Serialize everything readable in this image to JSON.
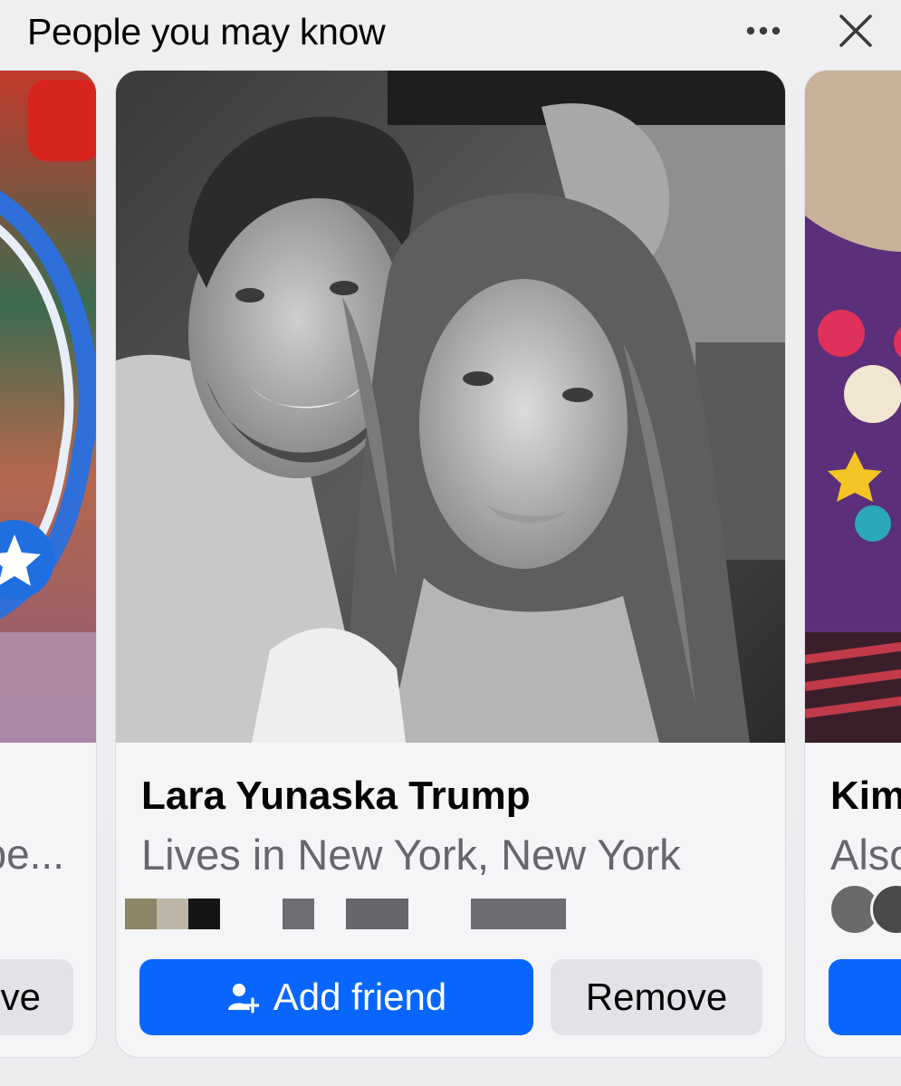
{
  "header": {
    "title": "People you may know",
    "more_icon": "more-horizontal-icon",
    "close_icon": "close-icon"
  },
  "cards": {
    "left": {
      "subtitle": "pe...",
      "button_label": "ve"
    },
    "main": {
      "name": "Lara Yunaska Trump",
      "subtitle": "Lives in New York, New York",
      "add_friend_label": "Add friend",
      "add_friend_icon": "add-person-icon",
      "remove_label": "Remove"
    },
    "right": {
      "name": "Kim",
      "subtitle": "Also"
    }
  },
  "colors": {
    "primary_blue": "#0866ff",
    "secondary_gray": "#e2e3e6",
    "text_primary": "#050505",
    "text_secondary": "#65676b"
  }
}
